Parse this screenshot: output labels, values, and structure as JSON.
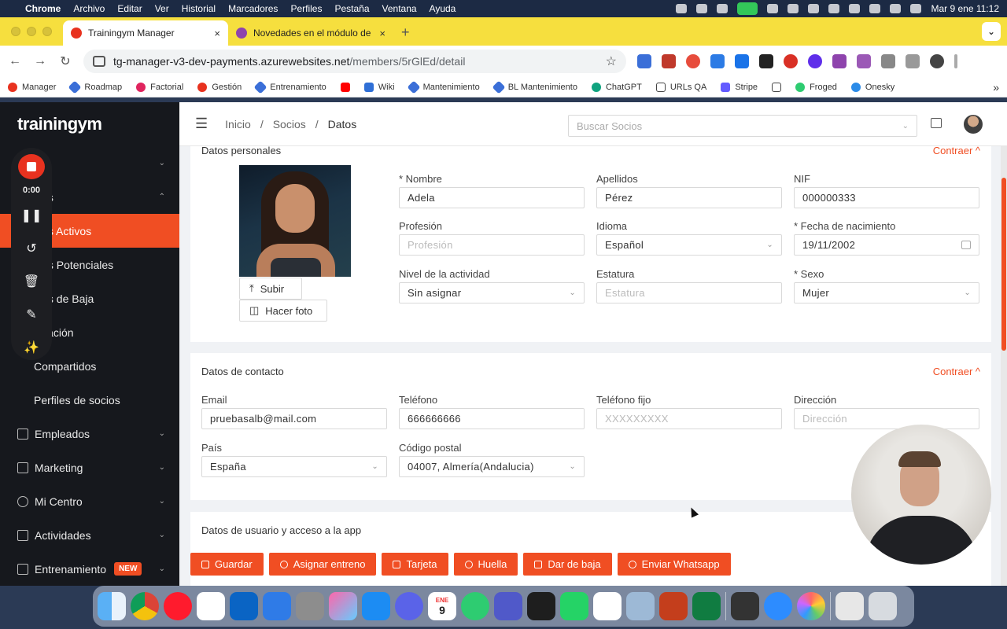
{
  "menubar": {
    "app": "Chrome",
    "items": [
      "Archivo",
      "Editar",
      "Ver",
      "Historial",
      "Marcadores",
      "Perfiles",
      "Pestaña",
      "Ventana",
      "Ayuda"
    ],
    "clock": "Mar 9 ene  11:12"
  },
  "browser": {
    "tabs": [
      {
        "title": "Trainingym Manager",
        "close": "×",
        "favicon_color": "#e8321f"
      },
      {
        "title": "Novedades en el módulo de p",
        "close": "×",
        "favicon_color": "#8e44ad"
      }
    ],
    "new_tab": "+",
    "url_host": "tg-manager-v3-dev-payments.azurewebsites.net",
    "url_path": "/members/5rGlEd/detail",
    "bookmarks": [
      "Manager",
      "Roadmap",
      "Factorial",
      "Gestión",
      "Entrenamiento",
      "Wiki",
      "Mantenimiento",
      "BL Mantenimiento",
      "ChatGPT",
      "URLs QA",
      "Stripe",
      "Froged",
      "Onesky"
    ],
    "bookmarks_more": "»"
  },
  "sidebar": {
    "logo": "trainingym",
    "items": [
      {
        "label": "cio",
        "arrow": "⌄"
      },
      {
        "label": "cios",
        "arrow": "⌃"
      },
      {
        "label": "cios Activos",
        "active": true
      },
      {
        "label": "cios Potenciales"
      },
      {
        "label": "cios de Baja"
      },
      {
        "label": "ificación"
      },
      {
        "label": "Compartidos"
      },
      {
        "label": "Perfiles de socios"
      }
    ],
    "sections": [
      {
        "label": "Empleados",
        "arrow": "⌄"
      },
      {
        "label": "Marketing",
        "arrow": "⌄"
      },
      {
        "label": "Mi Centro",
        "arrow": "⌄"
      },
      {
        "label": "Actividades",
        "arrow": "⌄"
      },
      {
        "label": "Entrenamiento",
        "badge": "NEW",
        "arrow": "⌄"
      }
    ]
  },
  "recorder": {
    "time": "0:00",
    "pause": "❚❚",
    "restart": "↺",
    "delete": "🗑",
    "draw": "✎",
    "effects": "✨"
  },
  "topbar": {
    "breadcrumb": [
      "Inicio",
      "/",
      "Socios",
      "/",
      "Datos"
    ],
    "search_placeholder": "Buscar Socios"
  },
  "personal": {
    "title": "Datos personales",
    "collapse": "Contraer ^",
    "upload": "Subir",
    "take_photo": "Hacer foto",
    "fields": {
      "nombre": {
        "label": "* Nombre",
        "value": "Adela"
      },
      "apellidos": {
        "label": "Apellidos",
        "value": "Pérez"
      },
      "nif": {
        "label": "NIF",
        "value": "000000333"
      },
      "profesion": {
        "label": "Profesión",
        "placeholder": "Profesión"
      },
      "idioma": {
        "label": "Idioma",
        "value": "Español"
      },
      "nacimiento": {
        "label": "* Fecha de nacimiento",
        "value": "19/11/2002"
      },
      "nivel": {
        "label": "Nivel de la actividad",
        "value": "Sin asignar"
      },
      "estatura": {
        "label": "Estatura",
        "placeholder": "Estatura"
      },
      "sexo": {
        "label": "* Sexo",
        "value": "Mujer"
      }
    }
  },
  "contact": {
    "title": "Datos de contacto",
    "collapse": "Contraer ^",
    "fields": {
      "email": {
        "label": "Email",
        "value": "pruebasalb@mail.com"
      },
      "telefono": {
        "label": "Teléfono",
        "value": "666666666"
      },
      "fijo": {
        "label": "Teléfono fijo",
        "placeholder": "XXXXXXXXX"
      },
      "direccion": {
        "label": "Dirección",
        "placeholder": "Dirección"
      },
      "pais": {
        "label": "País",
        "value": "España"
      },
      "cp": {
        "label": "Código postal",
        "value": "04007, Almería(Andalucia)"
      }
    }
  },
  "access": {
    "title": "Datos de usuario y acceso a la app"
  },
  "actions": [
    "Guardar",
    "Asignar entreno",
    "Tarjeta",
    "Huella",
    "Dar de baja",
    "Enviar Whatsapp"
  ],
  "dock": {
    "calendar_month": "ENE",
    "calendar_day": "9"
  }
}
